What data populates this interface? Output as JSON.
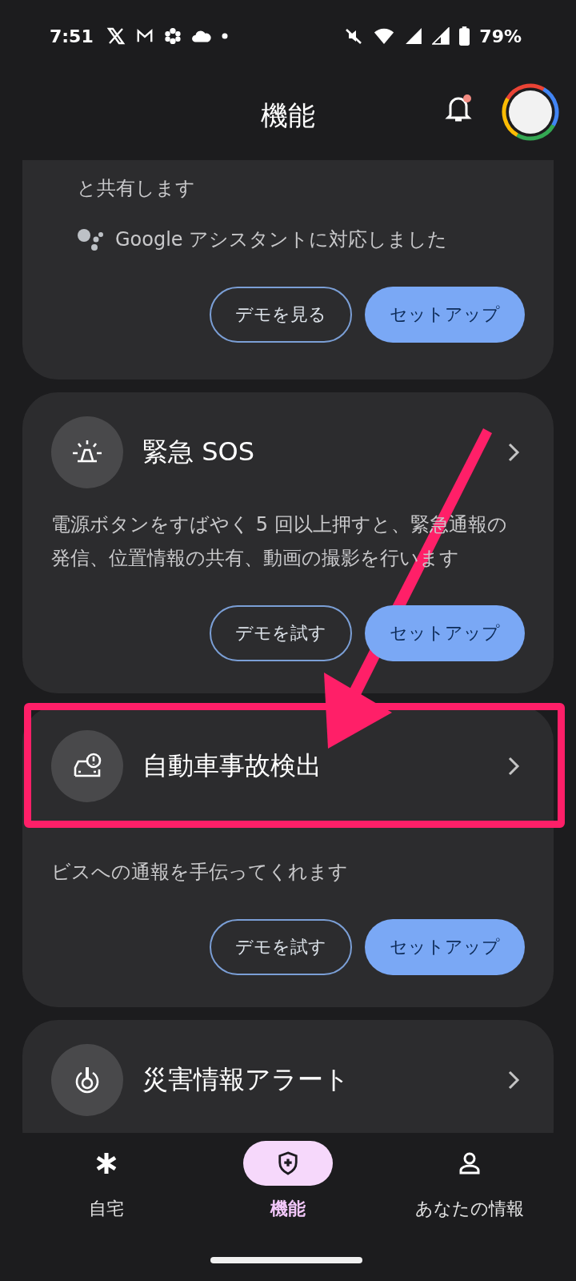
{
  "status_bar": {
    "time": "7:51",
    "battery": "79%"
  },
  "header": {
    "title": "機能"
  },
  "cards": [
    {
      "kind": "continued",
      "lines": [
        "と共有します"
      ],
      "note": "Google アシスタントに対応しました",
      "buttons": [
        {
          "label": "デモを見る",
          "kind": "outlined"
        },
        {
          "label": "セットアップ",
          "kind": "filled"
        }
      ]
    },
    {
      "kind": "feature",
      "title": "緊急 SOS",
      "description": "電源ボタンをすばやく 5 回以上押すと、緊急通報の発信、位置情報の共有、動画の撮影を行います",
      "annotated": false,
      "buttons": [
        {
          "label": "デモを試す",
          "kind": "outlined"
        },
        {
          "label": "セットアップ",
          "kind": "filled"
        }
      ]
    },
    {
      "kind": "feature",
      "title": "自動車事故検出",
      "description": "ビスへの通報を手伝ってくれます",
      "annotated": true,
      "buttons": [
        {
          "label": "デモを試す",
          "kind": "outlined"
        },
        {
          "label": "セットアップ",
          "kind": "filled"
        }
      ]
    },
    {
      "kind": "feature",
      "title": "災害情報アラート",
      "annotated": false
    }
  ],
  "nav": [
    {
      "label": "自宅",
      "selected": false
    },
    {
      "label": "機能",
      "selected": true
    },
    {
      "label": "あなたの情報",
      "selected": false
    }
  ]
}
